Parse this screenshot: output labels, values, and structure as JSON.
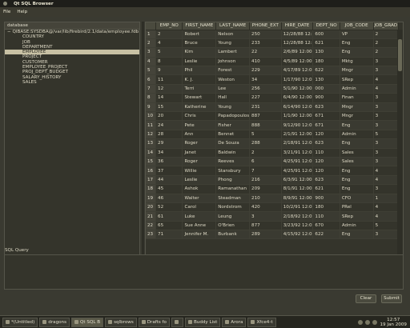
{
  "window": {
    "title": "Qt SQL Browser"
  },
  "menu": {
    "file": "File",
    "help": "Help"
  },
  "tree": {
    "header": "database",
    "root": "QIBASE:SYSDBA@/var/lib/firebird/2.1/data/employee.fdb",
    "tables": [
      "COUNTRY",
      "JOB",
      "DEPARTMENT",
      "EMPLOYEE",
      "PROJECT",
      "CUSTOMER",
      "EMPLOYEE_PROJECT",
      "PROJ_DEPT_BUDGET",
      "SALARY_HISTORY",
      "SALES"
    ],
    "selected": "EMPLOYEE"
  },
  "grid": {
    "columns": [
      "EMP_NO",
      "FIRST_NAME",
      "LAST_NAME",
      "PHONE_EXT",
      "HIRE_DATE",
      "DEPT_NO",
      "JOB_CODE",
      "JOB_GRAD"
    ],
    "rows": [
      [
        "1",
        "2",
        "Robert",
        "Nelson",
        "250",
        "12/28/88 12:0...",
        "600",
        "VP",
        "2"
      ],
      [
        "2",
        "4",
        "Bruce",
        "Young",
        "233",
        "12/28/88 12:0...",
        "621",
        "Eng",
        "2"
      ],
      [
        "3",
        "5",
        "Kim",
        "Lambert",
        "22",
        "2/6/89 12:00:...",
        "130",
        "Eng",
        "2"
      ],
      [
        "4",
        "8",
        "Leslie",
        "Johnson",
        "410",
        "4/5/89 12:00:...",
        "180",
        "Mktg",
        "3"
      ],
      [
        "5",
        "9",
        "Phil",
        "Forest",
        "229",
        "4/17/89 12:0...",
        "622",
        "Mngr",
        "3"
      ],
      [
        "6",
        "11",
        "K. J.",
        "Weston",
        "34",
        "1/17/90 12:0...",
        "130",
        "SRep",
        "4"
      ],
      [
        "7",
        "12",
        "Terri",
        "Lee",
        "256",
        "5/1/90 12:00:...",
        "000",
        "Admin",
        "4"
      ],
      [
        "8",
        "14",
        "Stewart",
        "Hall",
        "227",
        "6/4/90 12:00:...",
        "900",
        "Finan",
        "3"
      ],
      [
        "9",
        "15",
        "Katherine",
        "Young",
        "231",
        "6/14/90 12:0...",
        "623",
        "Mngr",
        "3"
      ],
      [
        "10",
        "20",
        "Chris",
        "Papadopoulos",
        "887",
        "1/1/90 12:00:...",
        "671",
        "Mngr",
        "3"
      ],
      [
        "11",
        "24",
        "Pete",
        "Fisher",
        "888",
        "9/12/90 12:0...",
        "671",
        "Eng",
        "3"
      ],
      [
        "12",
        "28",
        "Ann",
        "Bennet",
        "5",
        "2/1/91 12:00:...",
        "120",
        "Admin",
        "5"
      ],
      [
        "13",
        "29",
        "Roger",
        "De Souza",
        "288",
        "2/18/91 12:0...",
        "623",
        "Eng",
        "3"
      ],
      [
        "14",
        "34",
        "Janet",
        "Baldwin",
        "2",
        "3/21/91 12:0...",
        "110",
        "Sales",
        "3"
      ],
      [
        "15",
        "36",
        "Roger",
        "Reeves",
        "6",
        "4/25/91 12:0...",
        "120",
        "Sales",
        "3"
      ],
      [
        "16",
        "37",
        "Willie",
        "Stansbury",
        "7",
        "4/25/91 12:0...",
        "120",
        "Eng",
        "4"
      ],
      [
        "17",
        "44",
        "Leslie",
        "Phong",
        "216",
        "6/3/91 12:00:...",
        "623",
        "Eng",
        "4"
      ],
      [
        "18",
        "45",
        "Ashok",
        "Ramanathan",
        "209",
        "8/1/91 12:00:...",
        "621",
        "Eng",
        "3"
      ],
      [
        "19",
        "46",
        "Walter",
        "Steadman",
        "210",
        "8/9/91 12:00:...",
        "900",
        "CFO",
        "1"
      ],
      [
        "20",
        "52",
        "Carol",
        "Nordstrom",
        "420",
        "10/2/91 12:0...",
        "180",
        "PRel",
        "4"
      ],
      [
        "21",
        "61",
        "Luke",
        "Leung",
        "3",
        "2/18/92 12:0...",
        "110",
        "SRep",
        "4"
      ],
      [
        "22",
        "65",
        "Sue Anne",
        "O'Brien",
        "877",
        "3/23/92 12:0...",
        "670",
        "Admin",
        "5"
      ],
      [
        "23",
        "71",
        "Jennifer M.",
        "Burbank",
        "289",
        "4/15/92 12:0...",
        "622",
        "Eng",
        "3"
      ]
    ]
  },
  "sql": {
    "label": "SQL Query",
    "query": ""
  },
  "buttons": {
    "clear": "Clear",
    "submit": "Submit"
  },
  "taskbar": {
    "tasks": [
      "*(Untitled)",
      "dragons",
      "Qt SQL B",
      "sqlbrows",
      "Drafts fo",
      "",
      "Buddy List",
      "Arora",
      "Xfce4-t"
    ],
    "active_index": 2,
    "clock_time": "12:57",
    "clock_date": "19 Jan 2009"
  }
}
